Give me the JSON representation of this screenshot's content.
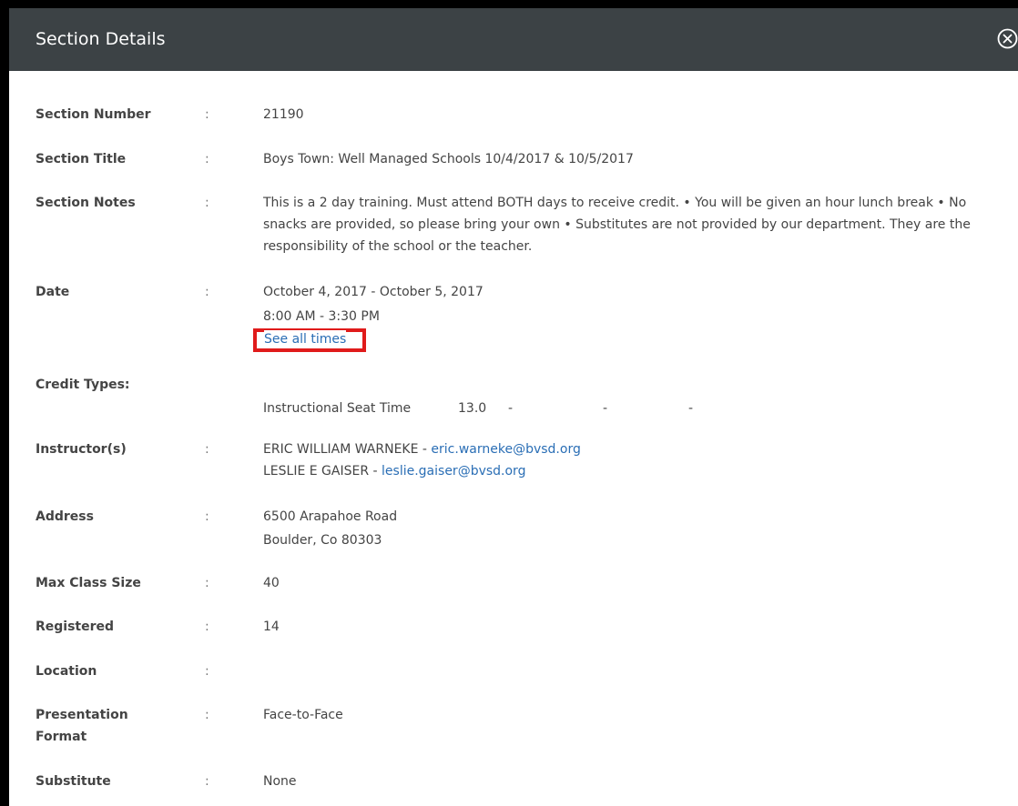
{
  "modal": {
    "title": "Section Details",
    "close_icon": "circle-x-icon"
  },
  "fields": {
    "section_number": {
      "label": "Section Number",
      "value": "21190"
    },
    "section_title": {
      "label": "Section Title",
      "value": "Boys Town: Well Managed Schools 10/4/2017 & 10/5/2017"
    },
    "section_notes": {
      "label": "Section Notes",
      "value": "This is a 2 day training. Must attend BOTH days to receive credit. • You will be given an hour lunch break • No snacks are provided, so please bring your own • Substitutes are not provided by our department. They are the responsibility of the school or the teacher."
    },
    "date": {
      "label": "Date",
      "value": "October 4, 2017 - October 5, 2017",
      "time": "8:00 AM - 3:30 PM",
      "see_all_link": "See all times"
    },
    "credit_types": {
      "label": "Credit Types:",
      "type": "Instructional Seat Time",
      "amount": "13.0",
      "dash1": "-",
      "dash2": "-",
      "dash3": "-"
    },
    "instructors": {
      "label": "Instructor(s)",
      "items": [
        {
          "name": "ERIC WILLIAM WARNEKE",
          "sep": " - ",
          "email": "eric.warneke@bvsd.org"
        },
        {
          "name": "LESLIE E GAISER",
          "sep": " - ",
          "email": "leslie.gaiser@bvsd.org"
        }
      ]
    },
    "address": {
      "label": "Address",
      "line1": "6500 Arapahoe Road",
      "line2": "Boulder, Co 80303"
    },
    "max_class_size": {
      "label": "Max Class Size",
      "value": "40"
    },
    "registered": {
      "label": "Registered",
      "value": "14"
    },
    "location": {
      "label": "Location",
      "value": ""
    },
    "presentation_format": {
      "label": "Presentation\nFormat",
      "value": "Face-to-Face"
    },
    "substitute": {
      "label": "Substitute",
      "value": "None"
    }
  },
  "separator": ":",
  "colors": {
    "header_bg": "#3c4245",
    "link": "#2a6eb5",
    "highlight": "#e01b1b"
  }
}
